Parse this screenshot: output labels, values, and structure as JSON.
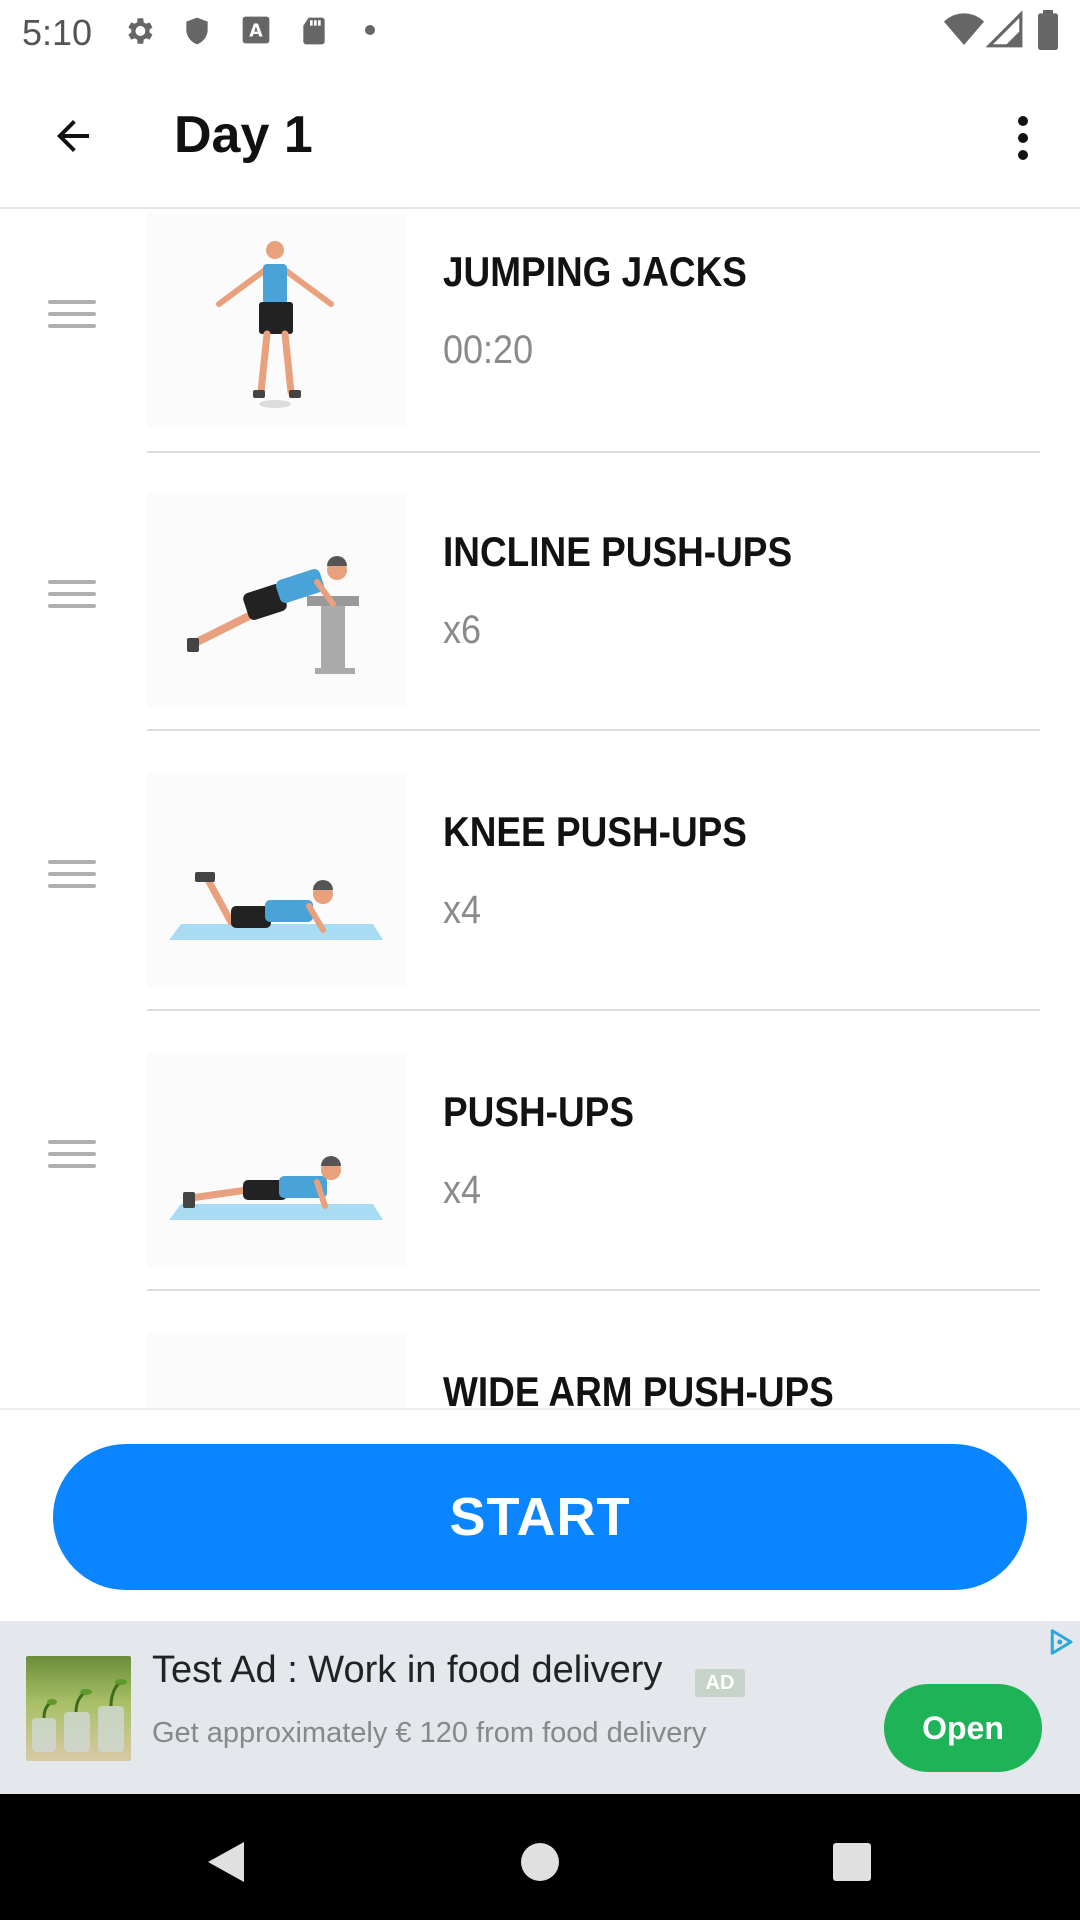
{
  "status_bar": {
    "time": "5:10",
    "icons": [
      "gear-icon",
      "shield-icon",
      "text-a-icon",
      "sd-card-icon",
      "dot-icon",
      "wifi-icon",
      "signal-icon",
      "battery-icon"
    ]
  },
  "app_bar": {
    "title": "Day 1",
    "back_icon": "arrow-left-icon",
    "menu_icon": "more-vertical-icon"
  },
  "exercises": [
    {
      "name": "JUMPING JACKS",
      "amount": "00:20",
      "image": "jumping-jacks-figure"
    },
    {
      "name": "INCLINE PUSH-UPS",
      "amount": "x6",
      "image": "incline-pushups-figure"
    },
    {
      "name": "KNEE PUSH-UPS",
      "amount": "x4",
      "image": "knee-pushups-figure"
    },
    {
      "name": "PUSH-UPS",
      "amount": "x4",
      "image": "pushups-figure"
    },
    {
      "name": "WIDE ARM PUSH-UPS",
      "amount": "",
      "image": "wide-arm-pushups-figure"
    }
  ],
  "start_button": {
    "label": "START",
    "color": "#0a84ff"
  },
  "ad": {
    "title": "Test Ad : Work in food delivery",
    "badge": "AD",
    "subtitle": "Get approximately € 120 from food delivery",
    "open_label": "Open",
    "open_color": "#1fb358"
  },
  "nav_bar": {
    "icons": [
      "back-triangle-icon",
      "home-circle-icon",
      "recents-square-icon"
    ]
  }
}
